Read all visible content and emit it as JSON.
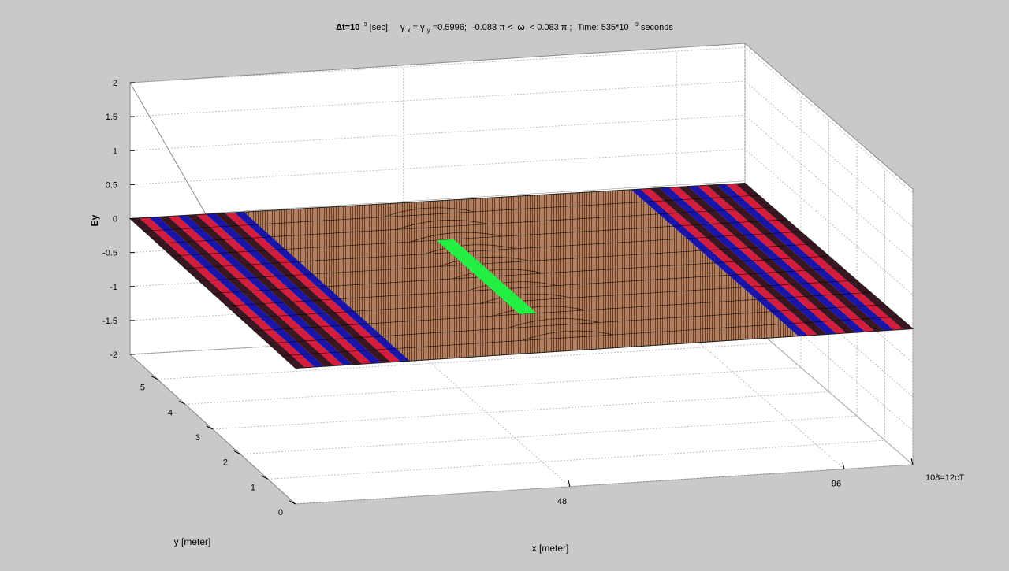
{
  "colors": {
    "figure_bg": "#c9c9c9",
    "axes_bg": "#ffffff",
    "surface_brown": "#b08060",
    "absorber_red": "#d41c3c",
    "absorber_blue": "#1a14a8",
    "absorber_dark": "#3a1620",
    "source": "#22ee44",
    "mesh_line": "#000000",
    "grid_line": "#bdbdbd",
    "box_line": "#8a8a8a"
  },
  "chart_data": {
    "type": "surface",
    "title": {
      "dt_label": "Δt=10",
      "dt_exp": "-9",
      "dt_unit": " [sec];",
      "gamma_x": "γ",
      "gamma_x_sub": "x",
      "eq": "=",
      "gamma_y": "γ",
      "gamma_y_sub": "y",
      "gamma_val": "=0.5996;",
      "omega_range_left": "-0.083 π <",
      "omega": "ω",
      "omega_range_right": "< 0.083 π ;",
      "time_label": "Time: 535*10",
      "time_exp": "-9",
      "time_unit": " seconds"
    },
    "zlabel": "Ey",
    "xlabel": "x [meter]",
    "ylabel": "y [meter]",
    "xlim": [
      0,
      108
    ],
    "ylim": [
      0,
      6
    ],
    "zlim": [
      -2,
      2
    ],
    "x_ticks": [
      {
        "value": 48,
        "label": "48"
      },
      {
        "value": 96,
        "label": "96"
      },
      {
        "value": 108,
        "label": "108=12cT"
      }
    ],
    "y_ticks": [
      {
        "value": 0,
        "label": "0"
      },
      {
        "value": 1,
        "label": "1"
      },
      {
        "value": 2,
        "label": "2"
      },
      {
        "value": 3,
        "label": "3"
      },
      {
        "value": 4,
        "label": "4"
      },
      {
        "value": 5,
        "label": "5"
      }
    ],
    "z_ticks": [
      {
        "value": 2,
        "label": "2"
      },
      {
        "value": 1.5,
        "label": "1.5"
      },
      {
        "value": 1,
        "label": "1"
      },
      {
        "value": 0.5,
        "label": "0.5"
      },
      {
        "value": 0,
        "label": "0"
      },
      {
        "value": -0.5,
        "label": "-0.5"
      },
      {
        "value": -1,
        "label": "-1"
      },
      {
        "value": -1.5,
        "label": "-1.5"
      },
      {
        "value": -2,
        "label": "-2"
      }
    ],
    "surface": {
      "ey_flat_value": 0,
      "absorbing_layer_left_x": [
        0,
        20
      ],
      "absorbing_layer_right_x": [
        88,
        108
      ],
      "source_line": {
        "x": 48,
        "y_range": [
          1.5,
          4.5
        ]
      },
      "wave_bump_x": [
        42,
        58
      ]
    },
    "grid": true,
    "view": "3d"
  }
}
